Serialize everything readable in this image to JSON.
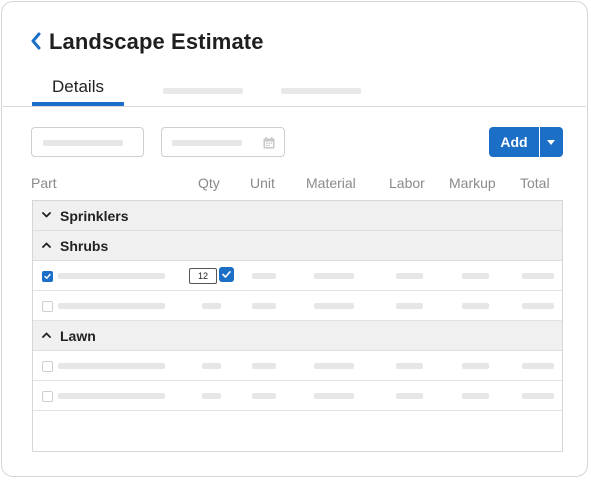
{
  "header": {
    "title": "Landscape Estimate",
    "back_icon": "chevron-left-icon"
  },
  "tabs": [
    {
      "label": "Details",
      "active": true
    },
    {
      "label": "",
      "active": false
    },
    {
      "label": "",
      "active": false
    }
  ],
  "toolbar": {
    "add_label": "Add",
    "add_menu_icon": "caret-down-icon",
    "date_icon": "calendar-icon"
  },
  "table": {
    "columns": [
      "Part",
      "Qty",
      "Unit",
      "Material",
      "Labor",
      "Markup",
      "Total"
    ],
    "groups": [
      {
        "label": "Sprinklers",
        "expanded": false
      },
      {
        "label": "Shrubs",
        "expanded": true
      },
      {
        "label": "Lawn",
        "expanded": true
      }
    ],
    "editing_qty": "12"
  },
  "colors": {
    "accent": "#1c6fc6",
    "group_bg": "#f0f0f0",
    "placeholder": "#e6e6e6",
    "header_text": "#8a8a8a"
  }
}
